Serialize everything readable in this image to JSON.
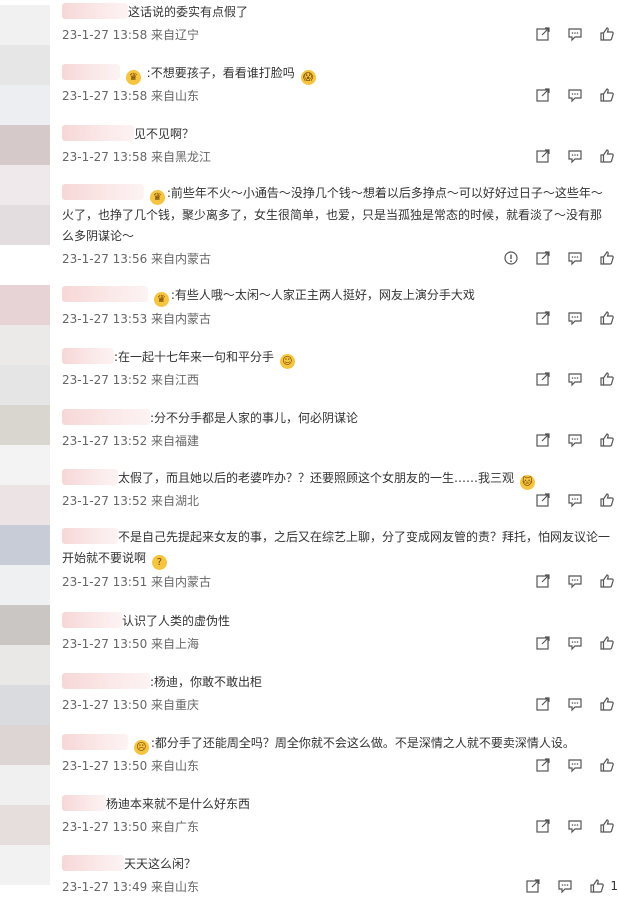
{
  "colors": {
    "text": "#333333",
    "meta": "#666666",
    "icon": "#555555"
  },
  "comments": [
    {
      "text": "这话说的委实有点假了",
      "meta": "23-1-27 13:58 来自辽宁",
      "emoji": false
    },
    {
      "text": ":不想要孩子，看看谁打脸吗",
      "meta": "23-1-27 13:58 来自山东",
      "emoji": true
    },
    {
      "text": "见不见啊？",
      "meta": "23-1-27 13:58 来自黑龙江",
      "emoji": false
    },
    {
      "text": ":前些年不火～小通告～没挣几个钱～想着以后多挣点～可以好好过日子～这些年～火了，也挣了几个钱，聚少离多了，女生很简单，也爱，只是当孤独是常态的时候，就看淡了～没有那么多阴谋论～",
      "meta": "23-1-27 13:56 来自内蒙古",
      "emoji": true
    },
    {
      "text": ":有些人哦～太闲～人家正主两人挺好，网友上演分手大戏",
      "meta": "23-1-27 13:53 来自内蒙古",
      "emoji": true
    },
    {
      "text": ":在一起十七年来一句和平分手",
      "meta": "23-1-27 13:52 来自江西",
      "emoji": true
    },
    {
      "text": ":分不分手都是人家的事儿，何必阴谋论",
      "meta": "23-1-27 13:52 来自福建",
      "emoji": false
    },
    {
      "text": "太假了，而且她以后的老婆咋办？？还要照顾这个女朋友的一生……我三观",
      "meta": "23-1-27 13:52 来自湖北",
      "emoji": true
    },
    {
      "text": "不是自己先提起来女友的事，之后又在综艺上聊，分了变成网友管的责？拜托，怕网友议论一开始就不要说啊",
      "meta": "23-1-27 13:51 来自内蒙古",
      "emoji": true
    },
    {
      "text": "认识了人类的虚伪性",
      "meta": "23-1-27 13:50 来自上海",
      "emoji": false
    },
    {
      "text": ":杨迪，你敢不敢出柜",
      "meta": "23-1-27 13:50 来自重庆",
      "emoji": false
    },
    {
      "text": ":都分手了还能周全吗？周全你就不会这么做。不是深情之人就不要卖深情人设。",
      "meta": "23-1-27 13:50 来自山东",
      "emoji": true
    },
    {
      "text": "杨迪本来就不是什么好东西",
      "meta": "23-1-27 13:50 来自广东",
      "emoji": false
    },
    {
      "text": "天天这么闲？",
      "meta": "23-1-27 13:49 来自山东",
      "emoji": false
    }
  ],
  "last_like_count": "1"
}
